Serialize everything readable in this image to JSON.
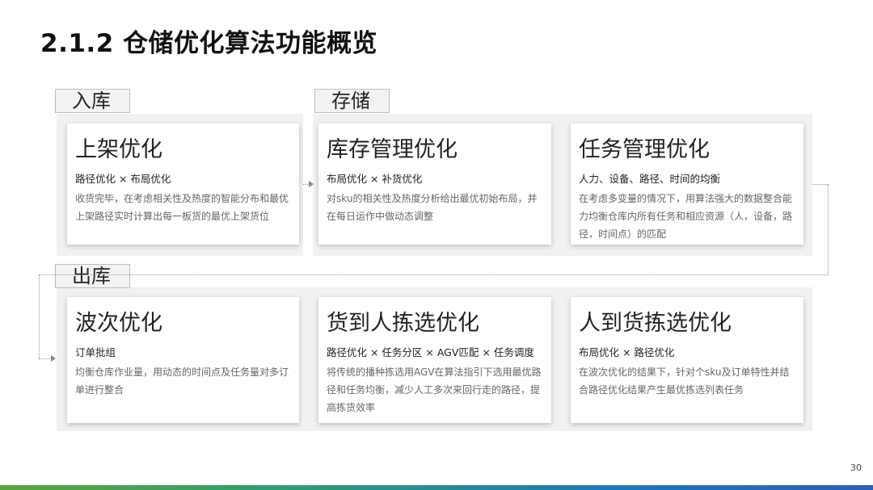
{
  "title": "2.1.2 仓储优化算法功能概览",
  "sections": {
    "inbound": "入库",
    "storage": "存储",
    "outbound": "出库"
  },
  "cards": [
    {
      "title": "上架优化",
      "sub": "路径优化 × 布局优化",
      "desc": "收货完毕，在考虑相关性及热度的智能分布和最优上架路径实时计算出每一板货的最优上架货位"
    },
    {
      "title": "库存管理优化",
      "sub": "布局优化 × 补货优化",
      "desc": "对sku的相关性及热度分析给出最优初始布局，并在每日运作中做动态调整"
    },
    {
      "title": "任务管理优化",
      "sub": "人力、设备、路径、时间的均衡",
      "desc": "在考虑多变量的情况下，用算法强大的数据整合能力均衡仓库内所有任务和相应资源（人，设备，路径，时间点）的匹配"
    },
    {
      "title": "波次优化",
      "sub": "订单批组",
      "desc": "均衡仓库作业量，用动态的时间点及任务量对多订单进行整合"
    },
    {
      "title": "货到人拣选优化",
      "sub": "路径优化 × 任务分区 × AGV匹配 × 任务调度",
      "desc": "将传统的播种拣选用AGV在算法指引下选用最优路径和任务均衡，减少人工多次来回行走的路径，提高拣货效率"
    },
    {
      "title": "人到货拣选优化",
      "sub": "布局优化 × 路径优化",
      "desc": "在波次优化的结果下，针对个sku及订单特性并结合路径优化结果产生最优拣选列表任务"
    }
  ],
  "page_number": "30",
  "colors": {
    "section_bg": "#f1f1f1",
    "gradient_start": "#5aa63c",
    "gradient_end": "#2a5fb5"
  }
}
